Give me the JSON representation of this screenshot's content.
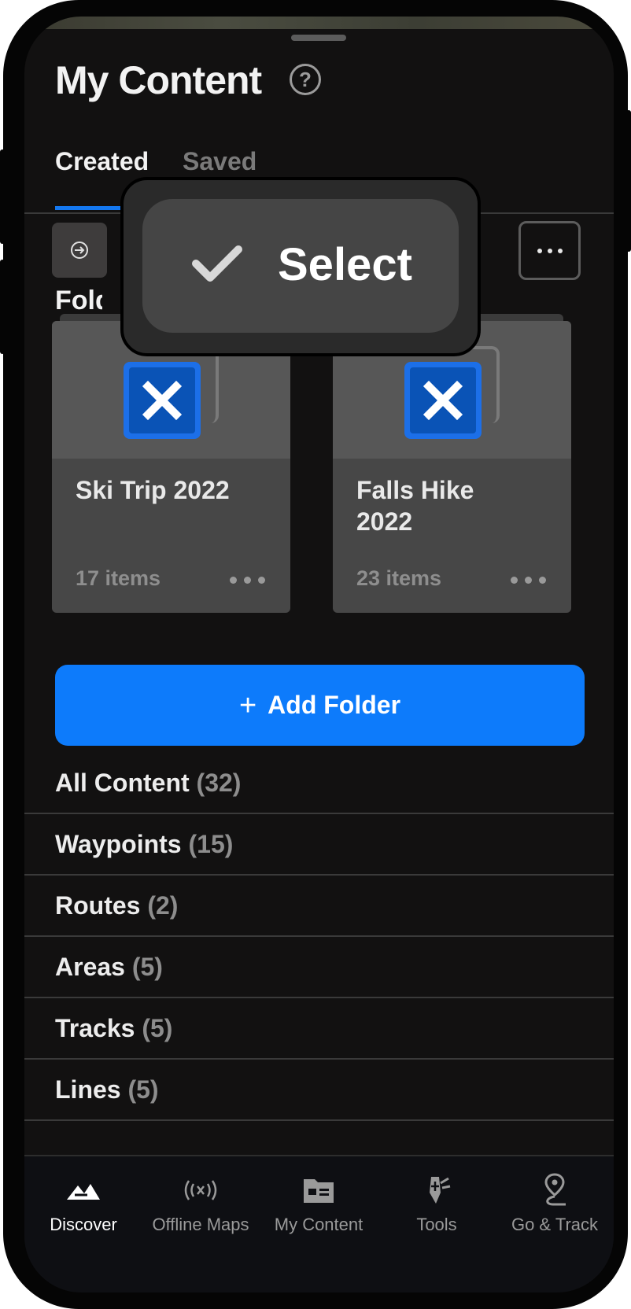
{
  "header": {
    "title": "My Content",
    "help_icon": "?"
  },
  "tabs": [
    {
      "label": "Created",
      "active": true
    },
    {
      "label": "Saved",
      "active": false
    }
  ],
  "toolbar": {
    "import_icon": "import-arrow-icon",
    "more_icon": "more-options-icon"
  },
  "folders": {
    "heading": "Folders",
    "items": [
      {
        "name": "Ski Trip 2022",
        "count": "17 items"
      },
      {
        "name": "Falls Hike 2022",
        "count": "23 items"
      }
    ]
  },
  "add_folder": {
    "icon": "+",
    "label": "Add Folder"
  },
  "categories": [
    {
      "label": "All Content",
      "count": "(32)"
    },
    {
      "label": "Waypoints",
      "count": "(15)"
    },
    {
      "label": "Routes",
      "count": "(2)"
    },
    {
      "label": "Areas",
      "count": "(5)"
    },
    {
      "label": "Tracks",
      "count": "(5)"
    },
    {
      "label": "Lines",
      "count": "(5)"
    }
  ],
  "popup": {
    "label": "Select",
    "icon": "checkmark-icon"
  },
  "bottom_nav": [
    {
      "label": "Discover",
      "icon": "discover-icon",
      "active": true
    },
    {
      "label": "Offline Maps",
      "icon": "offline-maps-icon",
      "active": false
    },
    {
      "label": "My Content",
      "icon": "my-content-icon",
      "active": false
    },
    {
      "label": "Tools",
      "icon": "tools-icon",
      "active": false
    },
    {
      "label": "Go & Track",
      "icon": "go-track-icon",
      "active": false
    }
  ],
  "colors": {
    "accent": "#0d7bfb",
    "background": "#121111",
    "card": "#474747"
  }
}
